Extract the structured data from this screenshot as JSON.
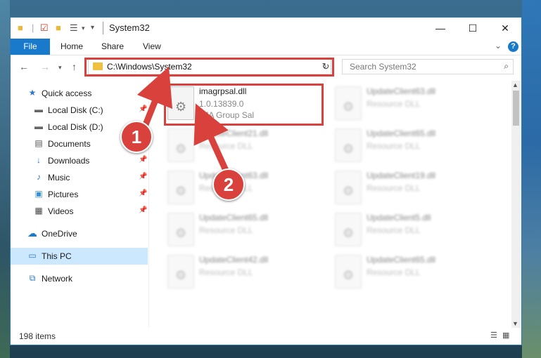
{
  "window": {
    "title": "System32",
    "controls": {
      "minimize": "—",
      "maximize": "☐",
      "close": "✕"
    }
  },
  "ribbon": {
    "file": "File",
    "tabs": [
      "Home",
      "Share",
      "View"
    ],
    "expand_icon": "chevron-down-icon",
    "help": "?"
  },
  "nav": {
    "address": "C:\\Windows\\System32",
    "search_placeholder": "Search System32"
  },
  "sidebar": {
    "items": [
      {
        "label": "Quick access",
        "icon": "star-icon",
        "pinned": false
      },
      {
        "label": "Local Disk (C:)",
        "icon": "drive-icon",
        "pinned": true
      },
      {
        "label": "Local Disk (D:)",
        "icon": "drive-icon",
        "pinned": true
      },
      {
        "label": "Documents",
        "icon": "document-icon",
        "pinned": true
      },
      {
        "label": "Downloads",
        "icon": "download-icon",
        "pinned": true
      },
      {
        "label": "Music",
        "icon": "music-icon",
        "pinned": true
      },
      {
        "label": "Pictures",
        "icon": "picture-icon",
        "pinned": true
      },
      {
        "label": "Videos",
        "icon": "video-icon",
        "pinned": true
      },
      {
        "label": "OneDrive",
        "icon": "cloud-icon",
        "pinned": false
      },
      {
        "label": "This PC",
        "icon": "computer-icon",
        "pinned": false,
        "selected": true
      },
      {
        "label": "Network",
        "icon": "network-icon",
        "pinned": false
      }
    ]
  },
  "files": [
    {
      "name": "imagrpsal.dll",
      "version": "1.0.13839.0",
      "company": "IMA Group Sal",
      "highlighted": true
    },
    {
      "name": "UpdateClient63.dll",
      "desc": "Resource DLL"
    },
    {
      "name": "UpdateClient21.dll",
      "desc": "Resource DLL"
    },
    {
      "name": "UpdateClient65.dll",
      "desc": "Resource DLL"
    },
    {
      "name": "UpdateClient63.dll",
      "desc": "Resource DLL"
    },
    {
      "name": "UpdateClient19.dll",
      "desc": "Resource DLL"
    },
    {
      "name": "UpdateClient65.dll",
      "desc": "Resource DLL"
    },
    {
      "name": "UpdateClient5.dll",
      "desc": "Resource DLL"
    },
    {
      "name": "UpdateClient42.dll",
      "desc": "Resource DLL"
    },
    {
      "name": "UpdateClient65.dll",
      "desc": "Resource DLL"
    }
  ],
  "status": {
    "count": "198 items"
  },
  "annotations": {
    "step1": "1",
    "step2": "2",
    "color": "#d9423c"
  }
}
